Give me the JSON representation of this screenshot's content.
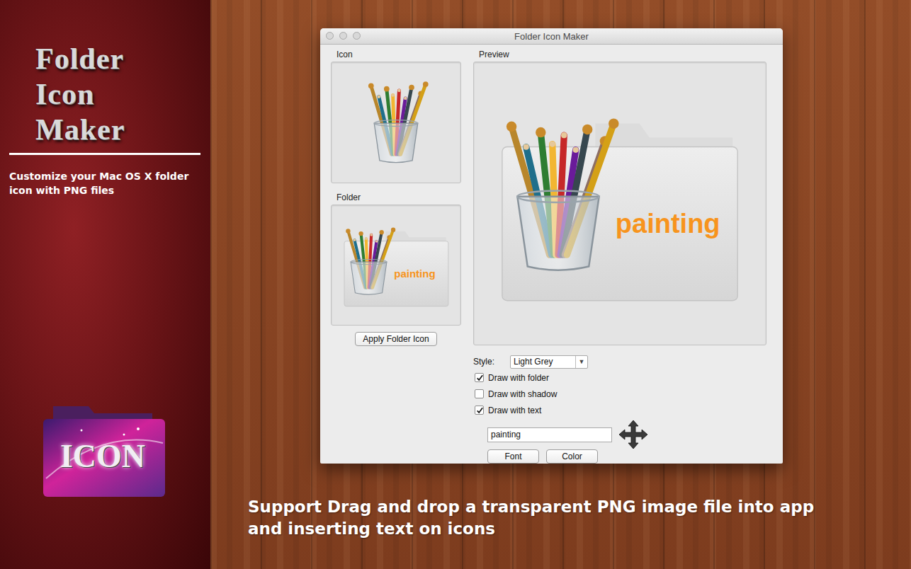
{
  "sidebar": {
    "title_lines": [
      "Folder",
      "Icon",
      "Maker"
    ],
    "tagline": "Customize your Mac OS X folder icon with PNG files",
    "logo_text": "ICON"
  },
  "window": {
    "title": "Folder Icon Maker"
  },
  "icon_panel": {
    "label": "Icon"
  },
  "folder_panel": {
    "label": "Folder",
    "overlay_text": "painting"
  },
  "apply_button": "Apply Folder Icon",
  "preview": {
    "label": "Preview",
    "overlay_text": "painting"
  },
  "style": {
    "label": "Style:",
    "value": "Light Grey",
    "arrow": "▼"
  },
  "options": [
    {
      "label": "Draw with folder",
      "checked": true
    },
    {
      "label": "Draw with shadow",
      "checked": false
    },
    {
      "label": "Draw with text",
      "checked": true
    }
  ],
  "text_field": {
    "value": "painting"
  },
  "buttons": [
    "Font",
    "Color"
  ],
  "caption_lines": [
    "Support Drag and drop a transparent PNG image file into app",
    "and inserting text on icons"
  ]
}
